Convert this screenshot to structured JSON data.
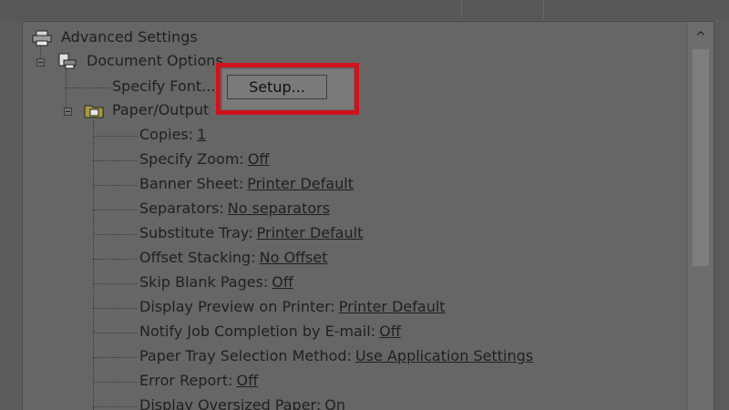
{
  "tree": {
    "root_label": "Advanced Settings",
    "document_options_label": "Document Options",
    "specify_font_label": "Specify Font...",
    "setup_button_label": "Setup...",
    "paper_output_label": "Paper/Output",
    "settings": [
      {
        "label": "Copies:",
        "value": "1"
      },
      {
        "label": "Specify Zoom:",
        "value": "Off"
      },
      {
        "label": "Banner Sheet:",
        "value": "Printer Default"
      },
      {
        "label": "Separators:",
        "value": "No separators"
      },
      {
        "label": "Substitute Tray:",
        "value": "Printer Default"
      },
      {
        "label": "Offset Stacking:",
        "value": "No Offset"
      },
      {
        "label": "Skip Blank Pages:",
        "value": "Off"
      },
      {
        "label": "Display Preview on Printer:",
        "value": "Printer Default"
      },
      {
        "label": "Notify Job Completion by E-mail:",
        "value": "Off"
      },
      {
        "label": "Paper Tray Selection Method:",
        "value": "Use Application Settings"
      },
      {
        "label": "Error Report:",
        "value": "Off"
      },
      {
        "label": "Display Oversized Paper:",
        "value": "On"
      }
    ]
  },
  "scrollbar": {
    "up_arrow": "^"
  },
  "colors": {
    "highlight": "#d0121e",
    "panel": "#666666",
    "text": "#202020"
  },
  "icons": {
    "root": "printer-icon",
    "document_options": "document-printer-icon",
    "paper_output": "folder-icon"
  }
}
